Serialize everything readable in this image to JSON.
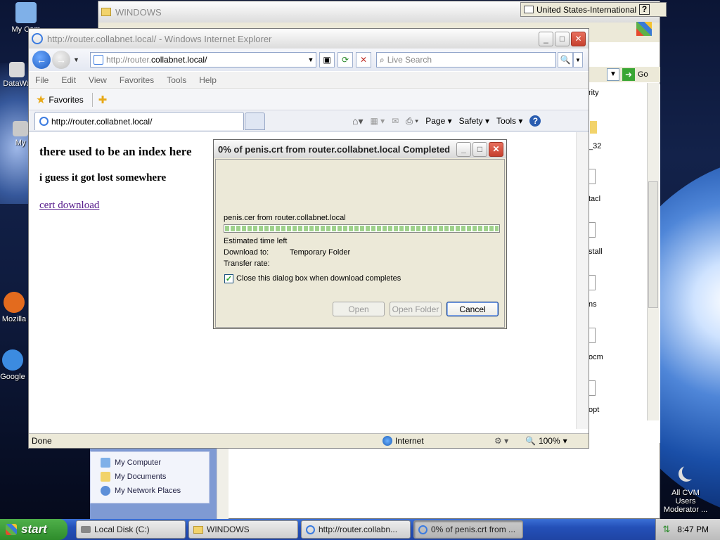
{
  "desktop": {
    "icons": [
      {
        "label": "My Com",
        "color": "#7fb0e8"
      },
      {
        "label": "DataWa",
        "color": "#d9d9d9"
      },
      {
        "label": "My",
        "color": "#c9c9c9"
      },
      {
        "label": "Mozilla",
        "color": "#e36b1e"
      },
      {
        "label": "Google",
        "color": "#3c8be0"
      }
    ],
    "overlay_text": {
      "line1": "All CVM Users",
      "line2": "Moderator ..."
    }
  },
  "language_bar": {
    "label": "United States-International",
    "help": "?"
  },
  "explorer": {
    "title": "WINDOWS",
    "go_label": "Go",
    "items": [
      "rity",
      "_32",
      "tacl",
      "stall",
      "ns",
      "ocm",
      "opt"
    ],
    "places": [
      {
        "label": "My Computer",
        "icon": "computer-icon"
      },
      {
        "label": "My Documents",
        "icon": "documents-icon"
      },
      {
        "label": "My Network Places",
        "icon": "network-icon"
      }
    ]
  },
  "ie": {
    "title": "http://router.collabnet.local/ - Windows Internet Explorer",
    "address_prefix": "http://router.",
    "address_host": "collabnet.local/",
    "search_placeholder": "Live Search",
    "menu": [
      "File",
      "Edit",
      "View",
      "Favorites",
      "Tools",
      "Help"
    ],
    "favorites_label": "Favorites",
    "tab_label": "http://router.collabnet.local/",
    "commands": {
      "page": "Page",
      "safety": "Safety",
      "tools": "Tools"
    },
    "page": {
      "heading1": "there used to be an index here",
      "heading2": "i guess it got lost somewhere",
      "link": "cert download"
    },
    "status": {
      "text": "Done",
      "zone": "Internet",
      "zoom": "100%"
    }
  },
  "download_dialog": {
    "title": "0% of penis.crt from router.collabnet.local Completed",
    "file_line": "penis.cer from router.collabnet.local",
    "progress": 1.0,
    "estimated_label": "Estimated time left",
    "download_to_label": "Download to:",
    "download_to_value": "Temporary Folder",
    "transfer_rate_label": "Transfer rate:",
    "close_checkbox_label": "Close this dialog box when download completes",
    "close_checked": true,
    "buttons": {
      "open": "Open",
      "open_folder": "Open Folder",
      "cancel": "Cancel"
    }
  },
  "taskbar": {
    "start_label": "start",
    "tasks": [
      {
        "label": "Local Disk (C:)",
        "active": false
      },
      {
        "label": "WINDOWS",
        "active": false
      },
      {
        "label": "http://router.collabn...",
        "active": false
      },
      {
        "label": "0% of penis.crt from ...",
        "active": true
      }
    ],
    "clock": "8:47 PM"
  }
}
